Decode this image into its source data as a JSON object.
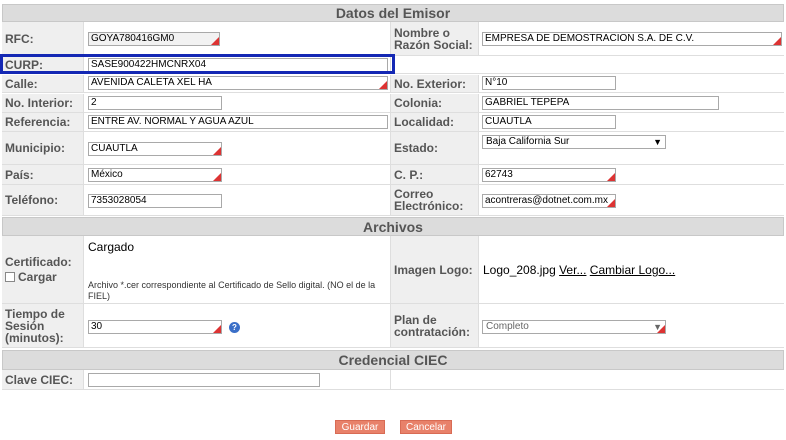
{
  "sections": {
    "emisor": "Datos del Emisor",
    "archivos": "Archivos",
    "ciec": "Credencial CIEC"
  },
  "fields": {
    "rfc_label": "RFC:",
    "rfc_value": "GOYA780416GM0",
    "nombre_label": "Nombre o Razón Social:",
    "nombre_value": "EMPRESA DE DEMOSTRACION S.A. DE C.V.",
    "curp_label": "CURP:",
    "curp_value": "SASE900422HMCNRX04",
    "calle_label": "Calle:",
    "calle_value": "AVENIDA CALETA XEL HA",
    "noext_label": "No. Exterior:",
    "noext_value": "N°10",
    "noint_label": "No. Interior:",
    "noint_value": "2",
    "colonia_label": "Colonia:",
    "colonia_value": "GABRIEL TEPEPA",
    "referencia_label": "Referencia:",
    "referencia_value": "ENTRE AV. NORMAL Y AGUA AZUL",
    "localidad_label": "Localidad:",
    "localidad_value": "CUAUTLA",
    "municipio_label": "Municipio:",
    "municipio_value": "CUAUTLA",
    "estado_label": "Estado:",
    "estado_value": "Baja California Sur",
    "pais_label": "País:",
    "pais_value": "México",
    "cp_label": "C. P.:",
    "cp_value": "62743",
    "telefono_label": "Teléfono:",
    "telefono_value": "7353028054",
    "correo_label": "Correo Electrónico:",
    "correo_value": "acontreras@dotnet.com.mx"
  },
  "archivos": {
    "certificado_label": "Certificado:",
    "cargar_label": "Cargar",
    "cargado_text": "Cargado",
    "cert_help": "Archivo *.cer correspondiente al Certificado de Sello digital. (NO el de la FIEL)",
    "imagen_label": "Imagen Logo:",
    "logo_file": "Logo_208.jpg",
    "ver_link": "Ver...",
    "cambiar_link": "Cambiar Logo...",
    "tiempo_label": "Tiempo de Sesión (minutos):",
    "tiempo_value": "30",
    "plan_label": "Plan de contratación:",
    "plan_value": "Completo"
  },
  "ciec": {
    "clave_label": "Clave CIEC:",
    "clave_value": ""
  },
  "buttons": {
    "guardar": "Guardar",
    "cancelar": "Cancelar"
  },
  "colors": {
    "highlight": "#1428b4",
    "button": "#e8816a",
    "required_marker": "#dd3333"
  }
}
